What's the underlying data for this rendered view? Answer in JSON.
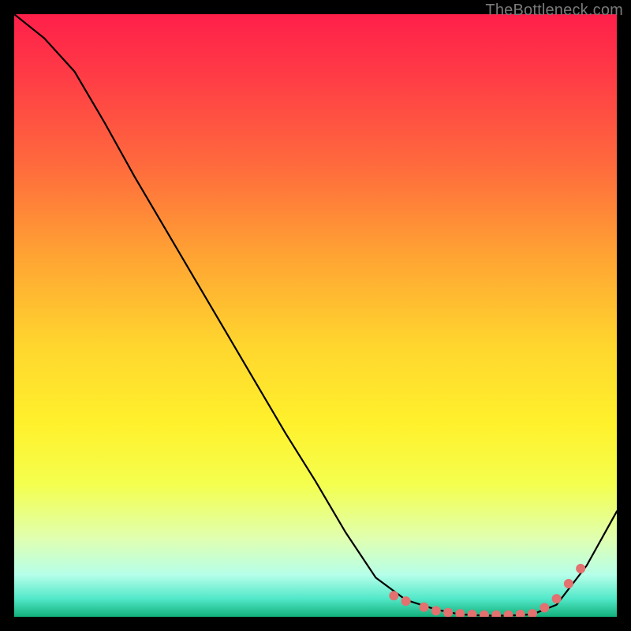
{
  "watermark": "TheBottleneck.com",
  "chart_data": {
    "type": "line",
    "x": [
      0.0,
      0.05,
      0.1,
      0.15,
      0.2,
      0.25,
      0.3,
      0.35,
      0.4,
      0.45,
      0.5,
      0.55,
      0.6,
      0.65,
      0.7,
      0.74,
      0.78,
      0.82,
      0.86,
      0.9,
      0.95,
      1.0
    ],
    "values": [
      1.0,
      0.96,
      0.905,
      0.82,
      0.73,
      0.645,
      0.56,
      0.475,
      0.39,
      0.305,
      0.225,
      0.14,
      0.065,
      0.028,
      0.012,
      0.004,
      0.002,
      0.002,
      0.004,
      0.02,
      0.085,
      0.175
    ],
    "marker_points": {
      "x": [
        0.63,
        0.65,
        0.68,
        0.7,
        0.72,
        0.74,
        0.76,
        0.78,
        0.8,
        0.82,
        0.84,
        0.86,
        0.88,
        0.9,
        0.92,
        0.94
      ],
      "y": [
        0.035,
        0.026,
        0.016,
        0.01,
        0.007,
        0.005,
        0.004,
        0.003,
        0.003,
        0.003,
        0.004,
        0.005,
        0.015,
        0.03,
        0.055,
        0.08
      ]
    },
    "title": "",
    "xlabel": "",
    "ylabel": "",
    "xlim": [
      0,
      1
    ],
    "ylim": [
      0,
      1
    ],
    "grid": false,
    "colors": {
      "line": "#000000",
      "marker": "#e2716f",
      "gradient_top": "#ff1f4a",
      "gradient_bottom": "#12b07a"
    }
  }
}
